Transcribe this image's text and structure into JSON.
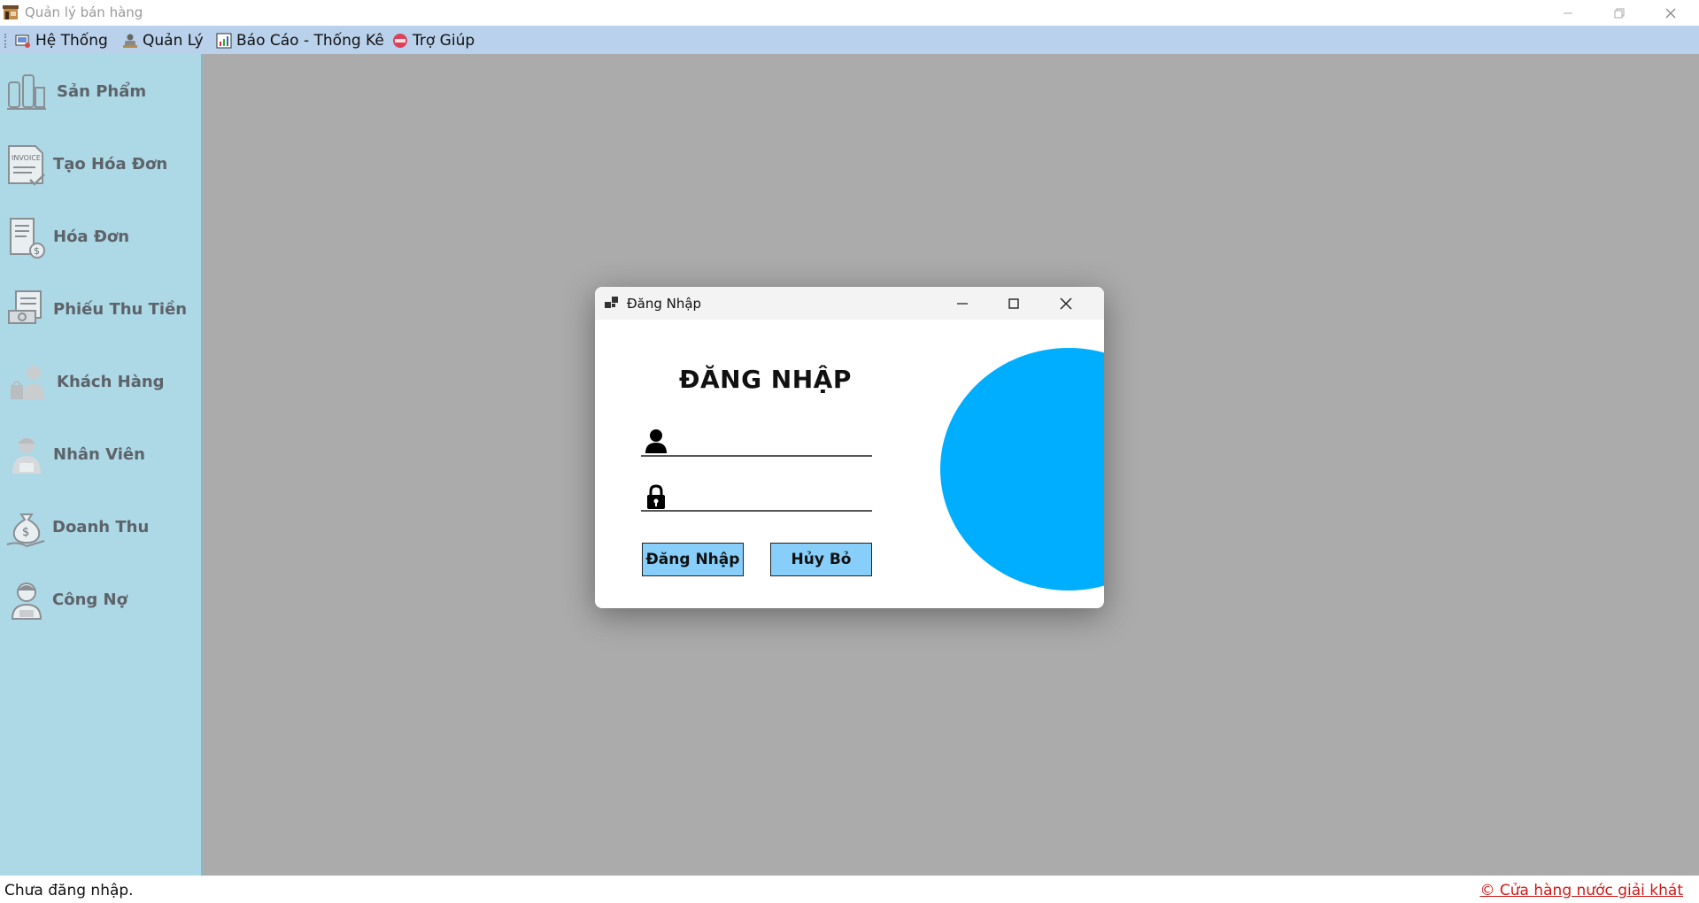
{
  "window": {
    "title": "Quản lý bán hàng"
  },
  "menu": {
    "items": [
      {
        "label": "Hệ Thống",
        "icon": "system-icon"
      },
      {
        "label": "Quản Lý",
        "icon": "manager-icon"
      },
      {
        "label": "Báo Cáo - Thống Kê",
        "icon": "report-chart-icon"
      },
      {
        "label": "Trợ Giúp",
        "icon": "help-icon"
      }
    ]
  },
  "sidebar": {
    "items": [
      {
        "label": "Sản Phẩm",
        "icon": "products-icon"
      },
      {
        "label": "Tạo Hóa Đơn",
        "icon": "invoice-icon"
      },
      {
        "label": "Hóa Đơn",
        "icon": "bill-icon"
      },
      {
        "label": "Phiếu Thu Tiền",
        "icon": "receipt-icon"
      },
      {
        "label": "Khách Hàng",
        "icon": "customer-icon"
      },
      {
        "label": "Nhân Viên",
        "icon": "employee-icon"
      },
      {
        "label": "Doanh Thu",
        "icon": "revenue-icon"
      },
      {
        "label": "Công Nợ",
        "icon": "debt-icon"
      }
    ]
  },
  "login": {
    "window_title": "Đăng Nhập",
    "heading": "ĐĂNG NHẬP",
    "username": {
      "value": "",
      "placeholder": ""
    },
    "password": {
      "value": "",
      "placeholder": ""
    },
    "login_button": "Đăng Nhập",
    "cancel_button": "Hủy Bỏ"
  },
  "status": {
    "left": "Chưa đăng nhập.",
    "right": "© Cửa hàng nước giải khát"
  },
  "colors": {
    "menubar": "#b9d1ea",
    "sidebar": "#add8e6",
    "workspace": "#ababab",
    "button": "#87cefa",
    "accent_circle": "#00aeff",
    "status_link": "#d01818"
  }
}
